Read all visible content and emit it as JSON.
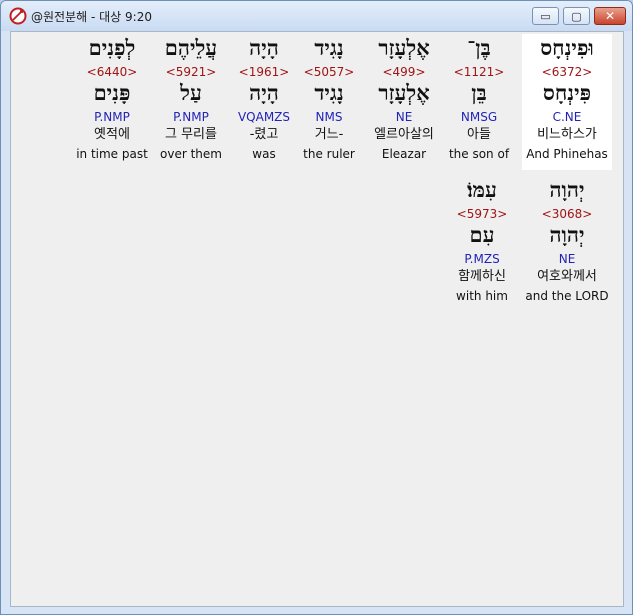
{
  "window": {
    "title": "@원전분해 - 대상 9:20",
    "buttons": {
      "minimize": "▭",
      "maximize": "▢",
      "close": "✕"
    }
  },
  "words": [
    {
      "hebrew": "וּפִינְחָס",
      "strong": "<6372>",
      "lemma": "פִּינְחָס",
      "parse": "C.NE",
      "korean": "비느하스가",
      "english": "And Phinehas",
      "selected": true
    },
    {
      "hebrew": "בֶּן־",
      "strong": "<1121>",
      "lemma": "בֵּן",
      "parse": "NMSG",
      "korean": "아들",
      "english": "the son of"
    },
    {
      "hebrew": "אֶלְעָזָר",
      "strong": "<499>",
      "lemma": "אֶלְעָזָר",
      "parse": "NE",
      "korean": "엘르아살의",
      "english": "Eleazar"
    },
    {
      "hebrew": "נָגִיד",
      "strong": "<5057>",
      "lemma": "נָגִיד",
      "parse": "NMS",
      "korean": "거느-",
      "english": "the ruler"
    },
    {
      "hebrew": "הָיָה",
      "strong": "<1961>",
      "lemma": "הָיָה",
      "parse": "VQAMZS",
      "korean": "-렸고",
      "english": "was"
    },
    {
      "hebrew": "עֲלֵיהֶם",
      "strong": "<5921>",
      "lemma": "עַל",
      "parse": "P.NMP",
      "korean": "그 무리를",
      "english": "over them"
    },
    {
      "hebrew": "לְפָנִים",
      "strong": "<6440>",
      "lemma": "פָּנִים",
      "parse": "P.NMP",
      "korean": "옛적에",
      "english": "in time past"
    },
    {
      "hebrew": "יְהוָה",
      "strong": "<3068>",
      "lemma": "יְהוָה",
      "parse": "NE",
      "korean": "여호와께서",
      "english": "and the LORD"
    },
    {
      "hebrew": "עִמּוֹ׃",
      "strong": "<5973>",
      "lemma": "עִם",
      "parse": "P.MZS",
      "korean": "함께하신",
      "english": "with him"
    }
  ]
}
